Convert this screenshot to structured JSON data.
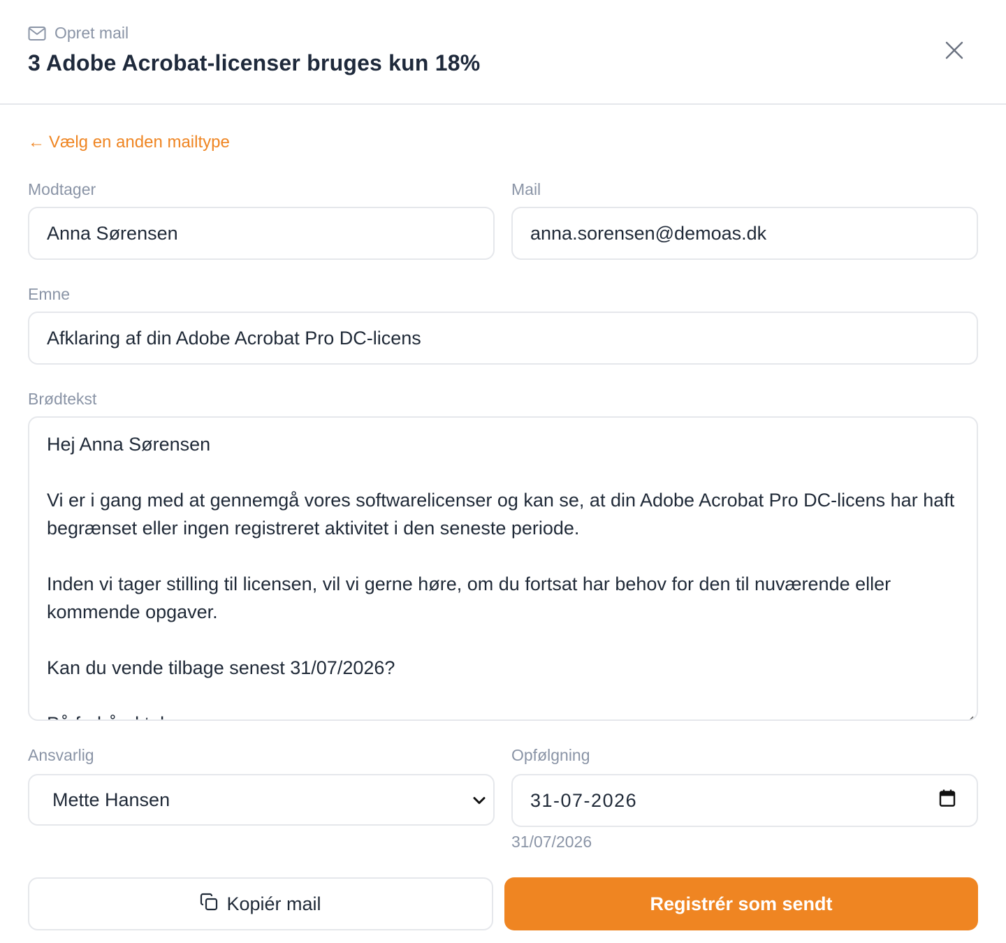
{
  "header": {
    "eyebrow": "Opret mail",
    "eyebrow_icon": "mail-icon",
    "title": "3 Adobe Acrobat-licenser bruges kun 18%",
    "close_icon": "close-icon"
  },
  "back_link": {
    "arrow": "←",
    "label": "Vælg en anden mailtype"
  },
  "form": {
    "recipient": {
      "label": "Modtager",
      "value": "Anna Sørensen"
    },
    "mail": {
      "label": "Mail",
      "value": "anna.sorensen@demoas.dk"
    },
    "subject": {
      "label": "Emne",
      "value": "Afklaring af din Adobe Acrobat Pro DC-licens"
    },
    "body": {
      "label": "Brødtekst",
      "lines": [
        "Hej Anna Sørensen",
        "Vi er i gang med at gennemgå vores softwarelicenser og kan se, at din Adobe Acrobat Pro DC-licens har haft begrænset eller ingen registreret aktivitet i den seneste periode.",
        "Inden vi tager stilling til licensen, vil vi gerne høre, om du fortsat har behov for den til nuværende eller kommende opgaver.",
        "Kan du vende tilbage senest 31/07/2026?",
        "På forhånd tak"
      ]
    },
    "responsible": {
      "label": "Ansvarlig",
      "value": "Mette Hansen"
    },
    "followup": {
      "label": "Opfølgning",
      "value": "31-07-2026",
      "hint": "31/07/2026"
    }
  },
  "actions": {
    "copy_label": "Kopiér mail",
    "copy_icon": "copy-icon",
    "register_label": "Registrér som sendt"
  },
  "colors": {
    "accent": "#ef8522",
    "muted": "#8a94a6",
    "border": "#e5e7eb"
  }
}
